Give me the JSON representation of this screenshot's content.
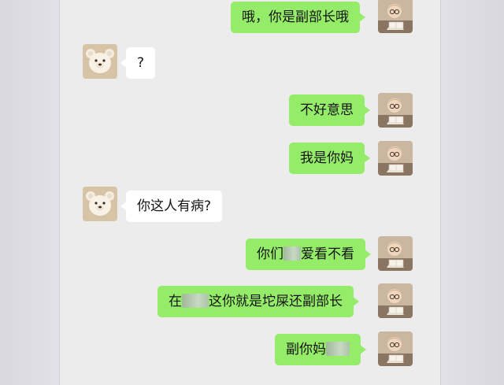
{
  "colors": {
    "outgoing_bubble": "#95ec69",
    "incoming_bubble": "#ffffff",
    "chat_background": "#ececec"
  },
  "messages": [
    {
      "side": "right",
      "text": "哦，你是副部长哦",
      "avatar": "reading-baby-avatar"
    },
    {
      "side": "left",
      "text": "?",
      "avatar": "teddy-bear-avatar"
    },
    {
      "side": "right",
      "text": "不好意思",
      "avatar": "reading-baby-avatar"
    },
    {
      "side": "right",
      "text": "我是你妈",
      "avatar": "reading-baby-avatar"
    },
    {
      "side": "left",
      "text": "你这人有病?",
      "avatar": "teddy-bear-avatar"
    },
    {
      "side": "right",
      "text_pre": "你们",
      "text_post": "爱看不看",
      "avatar": "reading-baby-avatar"
    },
    {
      "side": "right",
      "text_pre": "在",
      "text_post": "这你就是坨屎还副部长",
      "avatar": "reading-baby-avatar"
    },
    {
      "side": "right",
      "text_pre": "副你妈",
      "text_post": "",
      "avatar": "reading-baby-avatar"
    }
  ]
}
